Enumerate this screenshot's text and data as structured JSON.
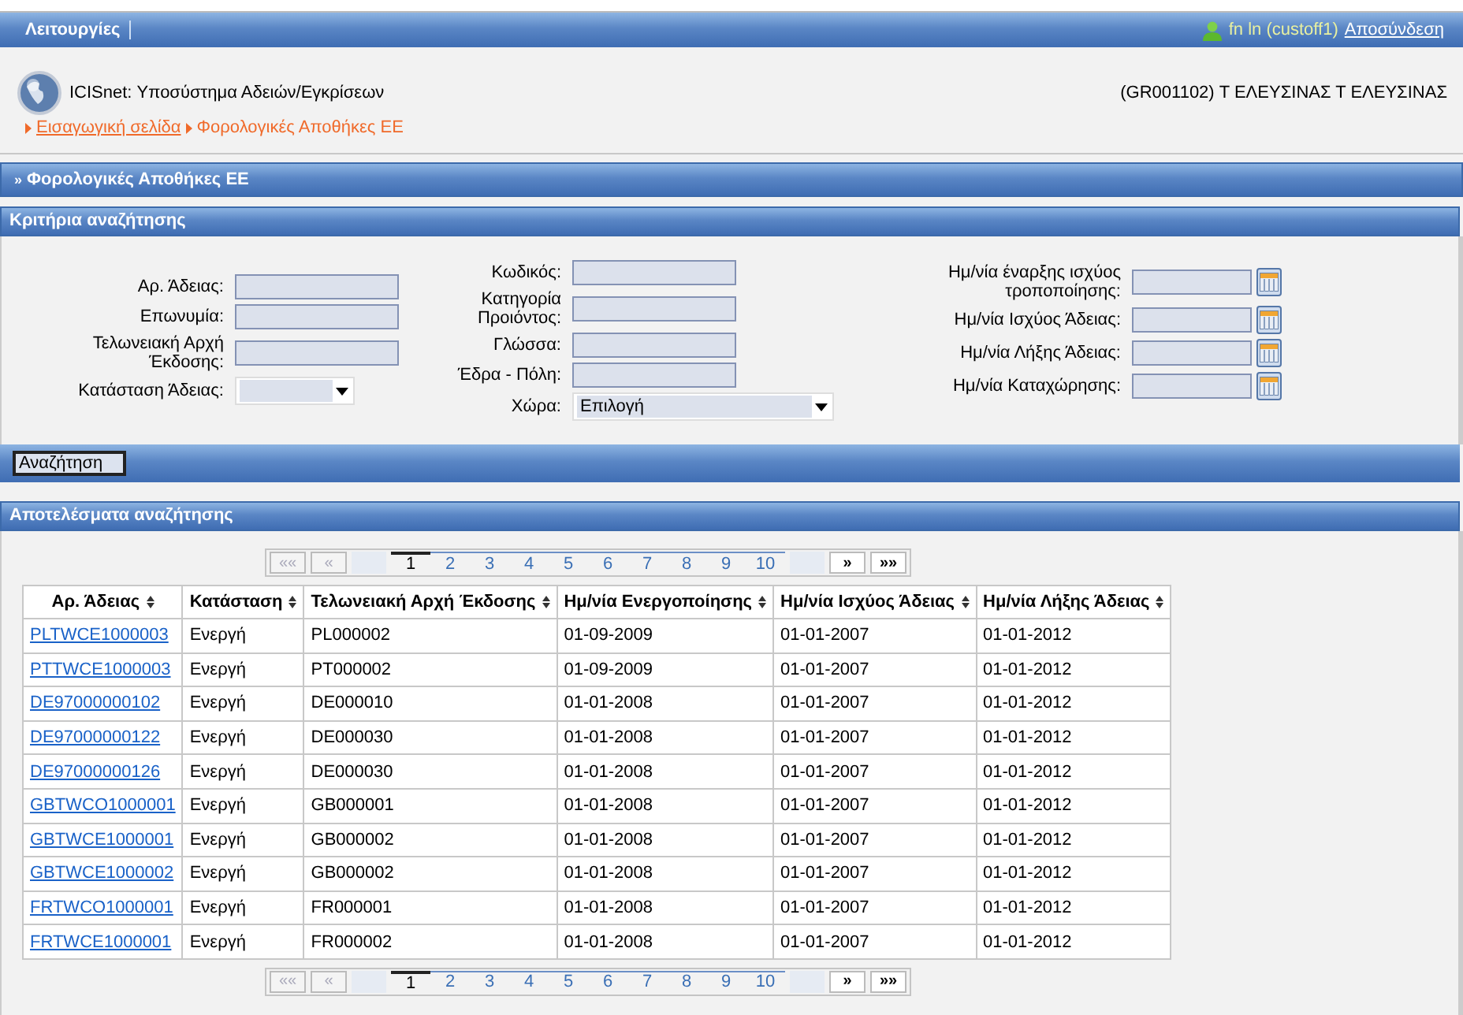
{
  "top_bar": {
    "menu_label": "Λειτουργίες",
    "user": "fn ln (custoff1)",
    "logout_link": "Αποσύνδεση"
  },
  "header": {
    "app_title": "ICISnet: Υποσύστημα Αδειών/Εγκρίσεων",
    "office": "(GR001102) Τ ΕΛΕΥΣΙΝΑΣ Τ ΕΛΕΥΣΙΝΑΣ",
    "breadcrumb": [
      {
        "label": "Εισαγωγική σελίδα",
        "kind": "link"
      },
      {
        "label": "Φορολογικές Αποθήκες ΕΕ",
        "kind": "current"
      }
    ]
  },
  "page_bar": {
    "marker": "»",
    "title": "Φορολογικές Αποθήκες ΕΕ"
  },
  "search_criteria": {
    "title": "Κριτήρια αναζήτησης",
    "columns": [
      [
        {
          "label": "Αρ. Άδειας:",
          "kind": "text"
        },
        {
          "label": "Επωνυμία:",
          "kind": "text"
        },
        {
          "label": "Τελωνειακή Αρχή Έκδοσης:",
          "kind": "text"
        },
        {
          "label": "Κατάσταση Άδειας:",
          "kind": "select"
        }
      ],
      [
        {
          "label": "Κωδικός:",
          "kind": "text"
        },
        {
          "label": "Κατηγορία Προιόντος:",
          "kind": "text"
        },
        {
          "label": "Γλώσσα:",
          "kind": "text"
        },
        {
          "label": "Έδρα - Πόλη:",
          "kind": "text"
        },
        {
          "label": "Χώρα:",
          "kind": "select",
          "value": "Επιλογή"
        }
      ],
      [
        {
          "label": "Ημ/νία έναρξης ισχύος τροποποίησης:",
          "kind": "date"
        },
        {
          "label": "Ημ/νία Ισχύος Άδειας:",
          "kind": "date"
        },
        {
          "label": "Ημ/νία Λήξης Άδειας:",
          "kind": "date"
        },
        {
          "label": "Ημ/νία Καταχώρησης:",
          "kind": "date"
        }
      ]
    ]
  },
  "search_button": "Αναζήτηση",
  "results": {
    "title": "Αποτελέσματα αναζήτησης",
    "pager_top": {
      "first": {
        "label": "««",
        "disabled": true
      },
      "prev": {
        "label": "«",
        "disabled": true
      },
      "pages": [
        {
          "label": "1",
          "selected": true
        },
        {
          "label": "2",
          "selected": false
        },
        {
          "label": "3",
          "selected": false
        },
        {
          "label": "4",
          "selected": false
        },
        {
          "label": "5",
          "selected": false
        },
        {
          "label": "6",
          "selected": false
        },
        {
          "label": "7",
          "selected": false
        },
        {
          "label": "8",
          "selected": false
        },
        {
          "label": "9",
          "selected": false
        },
        {
          "label": "10",
          "selected": false
        }
      ],
      "next": {
        "label": "»",
        "disabled": false
      },
      "last": {
        "label": "»»",
        "disabled": false
      }
    },
    "table": {
      "columns": [
        "Αρ. Άδειας",
        "Κατάσταση",
        "Τελωνειακή Αρχή Έκδοσης",
        "Ημ/νία Ενεργοποίησης",
        "Ημ/νία Ισχύος Άδειας",
        "Ημ/νία Λήξης Άδειας"
      ],
      "rows": [
        [
          "PLTWCE1000003",
          "Ενεργή",
          "PL000002",
          "01-09-2009",
          "01-01-2007",
          "01-01-2012"
        ],
        [
          "PTTWCE1000003",
          "Ενεργή",
          "PT000002",
          "01-09-2009",
          "01-01-2007",
          "01-01-2012"
        ],
        [
          "DE97000000102",
          "Ενεργή",
          "DE000010",
          "01-01-2008",
          "01-01-2007",
          "01-01-2012"
        ],
        [
          "DE97000000122",
          "Ενεργή",
          "DE000030",
          "01-01-2008",
          "01-01-2007",
          "01-01-2012"
        ],
        [
          "DE97000000126",
          "Ενεργή",
          "DE000030",
          "01-01-2008",
          "01-01-2007",
          "01-01-2012"
        ],
        [
          "GBTWCO1000001",
          "Ενεργή",
          "GB000001",
          "01-01-2008",
          "01-01-2007",
          "01-01-2012"
        ],
        [
          "GBTWCE1000001",
          "Ενεργή",
          "GB000002",
          "01-01-2008",
          "01-01-2007",
          "01-01-2012"
        ],
        [
          "GBTWCE1000002",
          "Ενεργή",
          "GB000002",
          "01-01-2008",
          "01-01-2007",
          "01-01-2012"
        ],
        [
          "FRTWCO1000001",
          "Ενεργή",
          "FR000001",
          "01-01-2008",
          "01-01-2007",
          "01-01-2012"
        ],
        [
          "FRTWCE1000001",
          "Ενεργή",
          "FR000002",
          "01-01-2008",
          "01-01-2007",
          "01-01-2012"
        ]
      ]
    },
    "pager_bottom": {
      "first": {
        "label": "««",
        "disabled": true
      },
      "prev": {
        "label": "«",
        "disabled": true
      },
      "pages": [
        {
          "label": "1",
          "selected": true
        },
        {
          "label": "2",
          "selected": false
        },
        {
          "label": "3",
          "selected": false
        },
        {
          "label": "4",
          "selected": false
        },
        {
          "label": "5",
          "selected": false
        },
        {
          "label": "6",
          "selected": false
        },
        {
          "label": "7",
          "selected": false
        },
        {
          "label": "8",
          "selected": false
        },
        {
          "label": "9",
          "selected": false
        },
        {
          "label": "10",
          "selected": false
        }
      ],
      "next": {
        "label": "»",
        "disabled": false
      },
      "last": {
        "label": "»»",
        "disabled": false
      }
    }
  }
}
